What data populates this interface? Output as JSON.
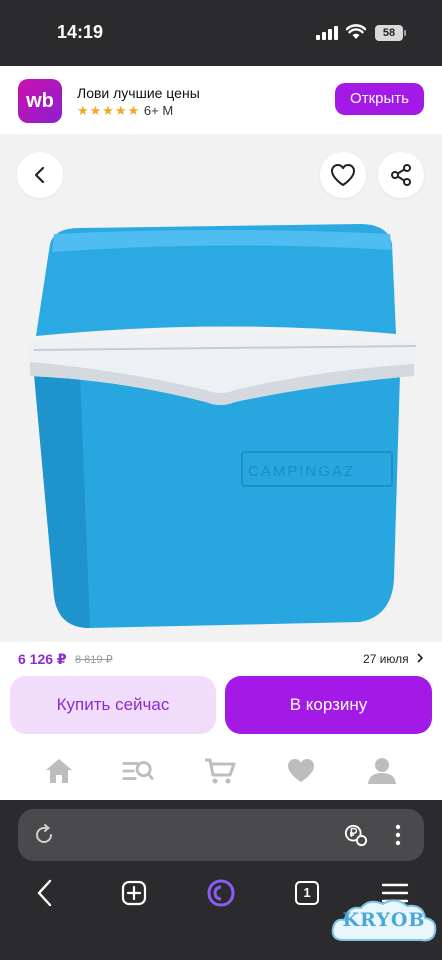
{
  "status_bar": {
    "time": "14:19",
    "battery": "58"
  },
  "app_banner": {
    "logo_text": "wb",
    "title": "Лови лучшие цены",
    "stars": "★★★★★",
    "age_rating": "6+ M",
    "open_label": "Открыть"
  },
  "product": {
    "image_icon": "cooler-box-image",
    "brand_text": "CAMPINGAZ"
  },
  "purchase": {
    "price": "6 126 ₽",
    "old_price": "8 819 ₽",
    "delivery": "27 июля",
    "buy_now_label": "Купить сейчас",
    "add_to_cart_label": "В корзину"
  },
  "bottom_nav": [
    "home-icon",
    "catalog-search-icon",
    "cart-icon",
    "favorites-icon",
    "profile-icon"
  ],
  "browser": {
    "tab_count": "1"
  },
  "watermark": "KRYOB",
  "colors": {
    "accent": "#a31ae6",
    "accent_light": "#f2dcfb",
    "price": "#8b2ccf",
    "cooler_blue": "#25a3de"
  }
}
